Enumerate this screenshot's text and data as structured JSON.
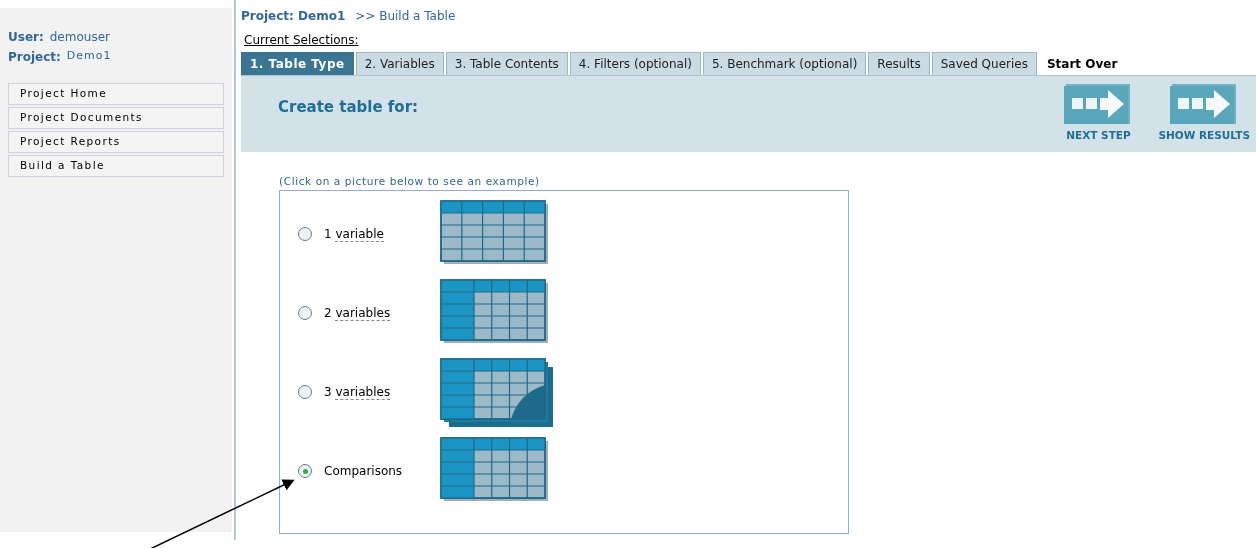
{
  "user": {
    "label": "User:",
    "value": "demouser"
  },
  "project": {
    "label": "Project:",
    "value": "Demo1"
  },
  "nav": [
    {
      "label": "Project Home",
      "selected": false
    },
    {
      "label": "Project Documents",
      "selected": false
    },
    {
      "label": "Project Reports",
      "selected": false
    },
    {
      "label": "Build a Table",
      "selected": false
    }
  ],
  "breadcrumb": {
    "project": "Project: Demo1",
    "path": ">> Build a Table"
  },
  "current_selections": "Current Selections:",
  "tabs": [
    {
      "label": "1. Table Type",
      "kind": "tab",
      "selected": true
    },
    {
      "label": "2. Variables",
      "kind": "tab",
      "selected": false
    },
    {
      "label": "3. Table Contents",
      "kind": "tab",
      "selected": false
    },
    {
      "label": "4. Filters (optional)",
      "kind": "tab",
      "selected": false
    },
    {
      "label": "5. Benchmark (optional)",
      "kind": "tab",
      "selected": false
    },
    {
      "label": "Results",
      "kind": "tab",
      "selected": false
    },
    {
      "label": "Saved Queries",
      "kind": "tab",
      "selected": false
    },
    {
      "label": "Start Over",
      "kind": "link",
      "selected": false
    }
  ],
  "panel": {
    "title": "Create table for:",
    "actions": [
      {
        "label": "NEXT STEP"
      },
      {
        "label": "SHOW RESULTS"
      }
    ]
  },
  "hint": "(Click on a picture below to see an example)",
  "options": [
    {
      "kind": "term",
      "number": "1",
      "term": "variable",
      "picture": {
        "kind": "one"
      },
      "selected": false
    },
    {
      "kind": "term",
      "number": "2",
      "term": "variables",
      "picture": {
        "kind": "two"
      },
      "selected": false
    },
    {
      "kind": "term",
      "number": "3",
      "term": "variables",
      "picture": {
        "kind": "three"
      },
      "selected": false
    },
    {
      "kind": "plain",
      "label": "Comparisons",
      "picture": {
        "kind": "comparisons"
      },
      "selected": true
    }
  ]
}
